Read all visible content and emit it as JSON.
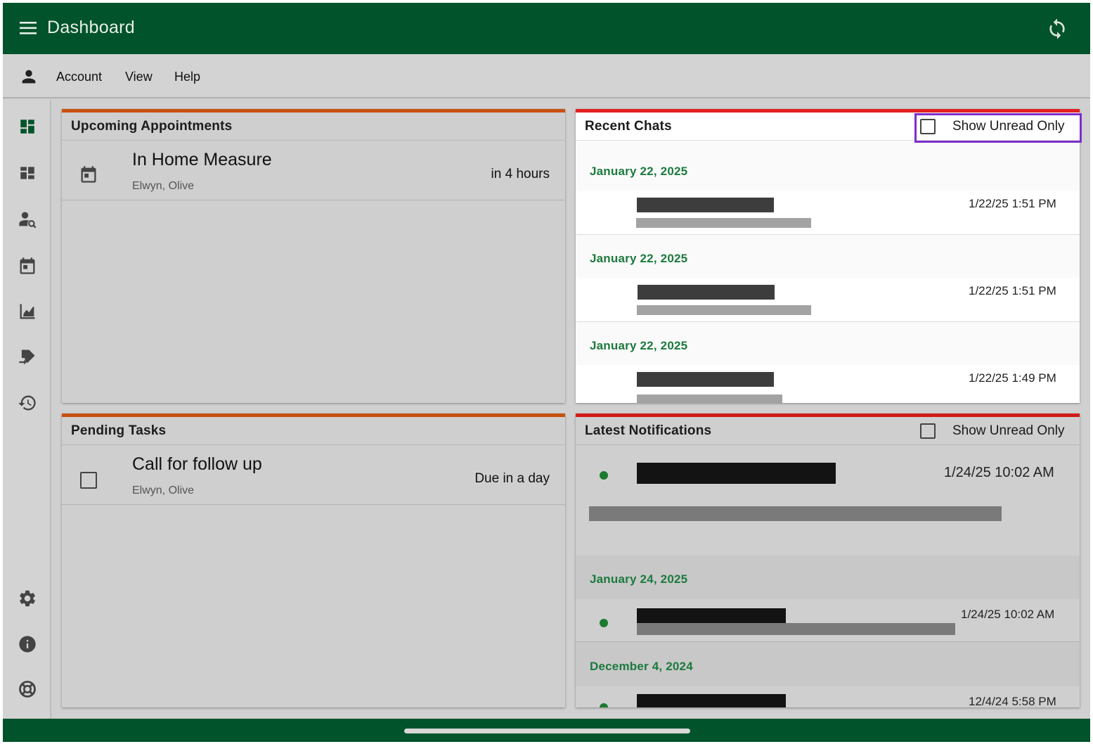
{
  "app": {
    "title": "Dashboard"
  },
  "menu": {
    "account": "Account",
    "view": "View",
    "help": "Help"
  },
  "icons": {
    "menu": "hamburger-icon",
    "sync": "sync-icon",
    "account": "person-icon",
    "rail": [
      "dashboard-icon",
      "widgets-icon",
      "person-search-icon",
      "calendar-icon",
      "chart-icon",
      "tag-transfer-icon",
      "history-icon",
      "settings-icon",
      "info-icon",
      "support-icon"
    ]
  },
  "colors": {
    "brand": "#00532b",
    "accent_orange": "#c7510e",
    "accent_red": "#d11a1a",
    "date_green": "#1b7a3d",
    "highlight": "#7b2fc9"
  },
  "appointments": {
    "title": "Upcoming Appointments",
    "items": [
      {
        "name": "In Home Measure",
        "client": "Elwyn, Olive",
        "when": "in 4 hours"
      }
    ]
  },
  "tasks": {
    "title": "Pending Tasks",
    "items": [
      {
        "name": "Call for follow up",
        "client": "Elwyn, Olive",
        "due": "Due in a day"
      }
    ]
  },
  "chats": {
    "title": "Recent Chats",
    "filter_label": "Show Unread Only",
    "groups": [
      {
        "date": "January 22, 2025",
        "time": "1/22/25 1:51 PM"
      },
      {
        "date": "January 22, 2025",
        "time": "1/22/25 1:51 PM"
      },
      {
        "date": "January 22, 2025",
        "time": "1/22/25 1:49 PM"
      }
    ]
  },
  "notifications": {
    "title": "Latest Notifications",
    "filter_label": "Show Unread Only",
    "first_time": "1/24/25 10:02 AM",
    "groups": [
      {
        "date": "January 24, 2025",
        "time": "1/24/25 10:02 AM"
      },
      {
        "date": "December 4, 2024",
        "time": "12/4/24 5:58 PM"
      }
    ]
  }
}
